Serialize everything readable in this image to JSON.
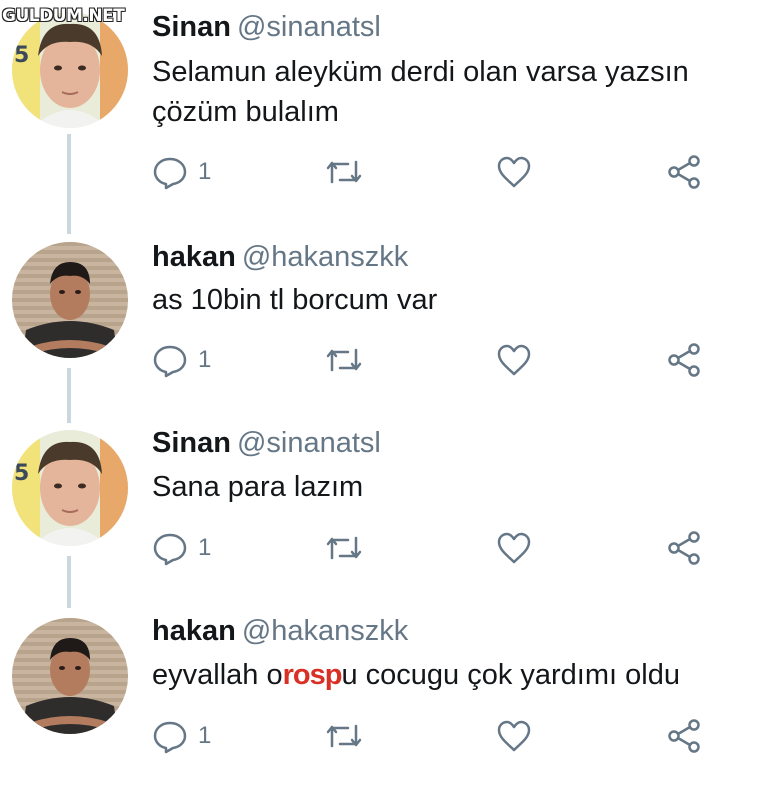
{
  "watermark": "GULDUM.NET",
  "tweets": [
    {
      "name": "Sinan",
      "handle": "@sinanatsl",
      "avatar_icon": "avatar-sinan",
      "text_parts": [
        "Selamun aleyküm derdi olan varsa yazsın çözüm bulalım"
      ],
      "reply_count": "1"
    },
    {
      "name": "hakan",
      "handle": "@hakanszkk",
      "avatar_icon": "avatar-hakan",
      "text_parts": [
        "as 10bin tl borcum var"
      ],
      "reply_count": "1"
    },
    {
      "name": "Sinan",
      "handle": "@sinanatsl",
      "avatar_icon": "avatar-sinan",
      "text_parts": [
        "Sana para lazım"
      ],
      "reply_count": "1"
    },
    {
      "name": "hakan",
      "handle": "@hakanszkk",
      "avatar_icon": "avatar-hakan",
      "text_before": "eyvallah o",
      "text_censored": "rosp",
      "text_after": "u cocugu çok yardımı oldu",
      "reply_count": "1"
    }
  ],
  "colors": {
    "text": "#14171a",
    "muted": "#657786",
    "thread_line": "#ccd6dd",
    "censor": "#d93025"
  },
  "icons": [
    "reply-icon",
    "retweet-icon",
    "like-icon",
    "share-icon"
  ]
}
